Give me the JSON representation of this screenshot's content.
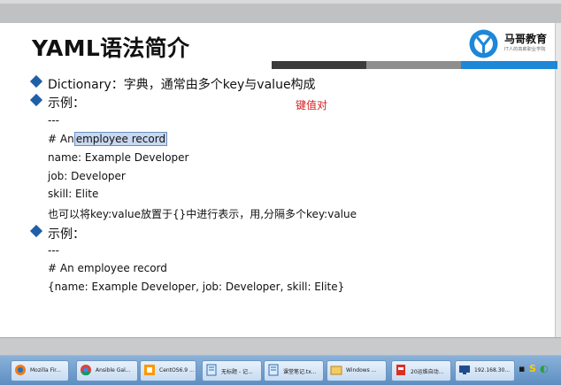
{
  "slide": {
    "title": "YAML语法简介",
    "logo_text": "马哥教育",
    "logo_sub": "IT人的高薪职业学院",
    "colors": {
      "bar_dark": "#3b3b3b",
      "bar_mid": "#8e8e8e",
      "bar_blue": "#1e87d8",
      "bullet": "#1f5fa8",
      "note_red": "#d61f1f"
    },
    "bullets": [
      "Dictionary：字典，通常由多个key与value构成",
      "示例：",
      "示例："
    ],
    "note": "键值对",
    "example1": {
      "l1": "---",
      "l2_prefix": "# An",
      "l2_highlight": "employee record",
      "l3": "name: Example Developer",
      "l4": "job: Developer",
      "l5": "skill: Elite",
      "l6": "也可以将key:value放置于{}中进行表示，用,分隔多个key:value"
    },
    "example2": {
      "l1": "---",
      "l2": "# An employee record",
      "l3": "{name: Example Developer, job: Developer, skill: Elite}"
    }
  },
  "taskbar": {
    "items": [
      {
        "label": "Mozilla Fir...",
        "icon": "firefox-icon"
      },
      {
        "label": "Ansible Gal...",
        "icon": "chrome-icon"
      },
      {
        "label": "CentOS6.9 ...",
        "icon": "vmware-icon"
      },
      {
        "label": "无标题 - 记...",
        "icon": "notepad-icon"
      },
      {
        "label": "课堂笔记.tx...",
        "icon": "notepad-icon"
      },
      {
        "label": "Windows ...",
        "icon": "windows-explorer-icon"
      },
      {
        "label": "20运维自动...",
        "icon": "pdf-icon"
      },
      {
        "label": "192.168.30...",
        "icon": "remote-desktop-icon"
      }
    ]
  }
}
